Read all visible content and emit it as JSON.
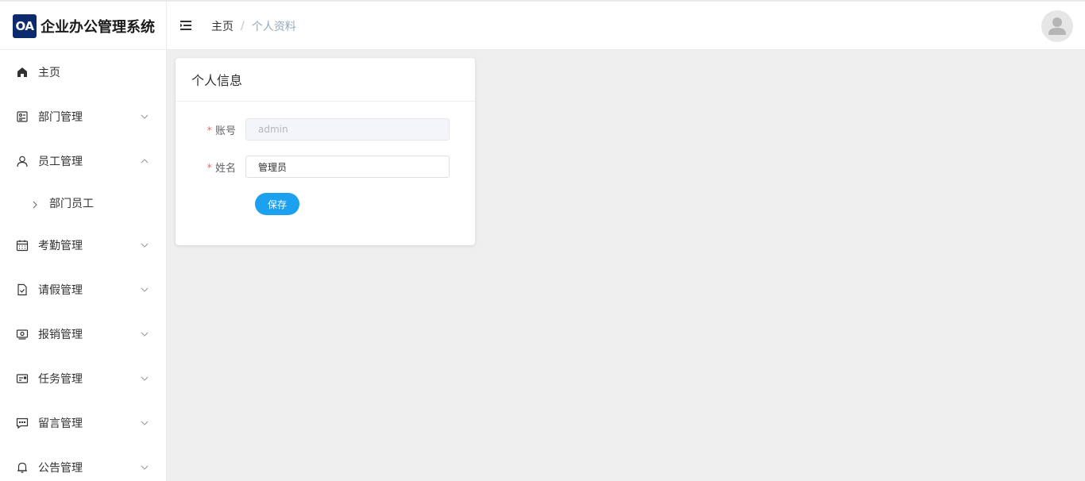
{
  "app": {
    "logo_badge": "OA",
    "title": "企业办公管理系统"
  },
  "breadcrumb": {
    "home": "主页",
    "separator": "/",
    "current": "个人资料"
  },
  "sidebar": {
    "items": [
      {
        "label": "主页",
        "icon": "home-icon",
        "expandable": false
      },
      {
        "label": "部门管理",
        "icon": "department-icon",
        "expandable": true,
        "expanded": false
      },
      {
        "label": "员工管理",
        "icon": "user-icon",
        "expandable": true,
        "expanded": true,
        "children": [
          {
            "label": "部门员工"
          }
        ]
      },
      {
        "label": "考勤管理",
        "icon": "calendar-icon",
        "expandable": true,
        "expanded": false
      },
      {
        "label": "请假管理",
        "icon": "document-check-icon",
        "expandable": true,
        "expanded": false
      },
      {
        "label": "报销管理",
        "icon": "money-icon",
        "expandable": true,
        "expanded": false
      },
      {
        "label": "任务管理",
        "icon": "task-card-icon",
        "expandable": true,
        "expanded": false
      },
      {
        "label": "留言管理",
        "icon": "chat-icon",
        "expandable": true,
        "expanded": false
      },
      {
        "label": "公告管理",
        "icon": "bell-icon",
        "expandable": true,
        "expanded": false
      }
    ]
  },
  "profile_card": {
    "title": "个人信息",
    "fields": {
      "account": {
        "label": "账号",
        "value": "admin",
        "required": true,
        "disabled": true
      },
      "name": {
        "label": "姓名",
        "value": "管理员",
        "required": true,
        "disabled": false
      }
    },
    "save_label": "保存"
  },
  "colors": {
    "primary_button": "#1ca0f0",
    "logo_badge": "#0d2a6e",
    "required_mark": "#f56c6c",
    "breadcrumb_current": "#97a8be",
    "background": "#efefef"
  }
}
